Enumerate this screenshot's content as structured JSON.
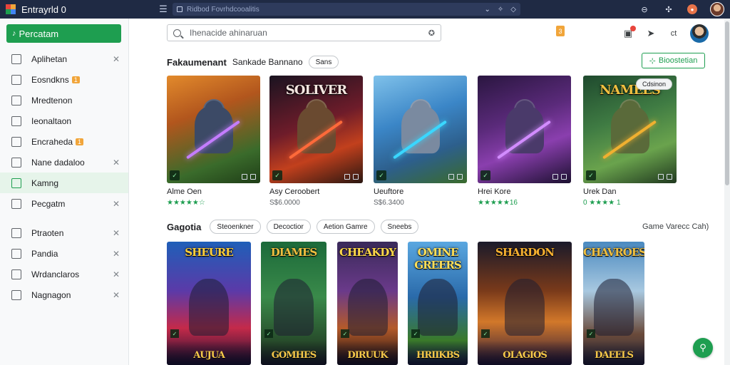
{
  "app": {
    "title": "Entrayrld 0"
  },
  "browser": {
    "address_placeholder": "Ridbod Fovrhdcooalitis"
  },
  "sidebar": {
    "primary_button": "Percatam",
    "items": [
      {
        "label": "Aplihetan",
        "closable": true
      },
      {
        "label": "Eosndkns",
        "badge": "1",
        "closable": false
      },
      {
        "label": "Mredtenon",
        "closable": false
      },
      {
        "label": "Ieonaltaon",
        "closable": false
      },
      {
        "label": "Encraheda",
        "badge": "1",
        "closable": false
      },
      {
        "label": "Nane dadaloo",
        "closable": true
      },
      {
        "label": "Kamng",
        "closable": false,
        "active": true
      },
      {
        "label": "Pecgatm",
        "closable": true
      },
      {
        "label": "Ptraoten",
        "closable": true
      },
      {
        "label": "Pandia",
        "closable": true
      },
      {
        "label": "Wrdanclaros",
        "closable": true
      },
      {
        "label": "Nagnagon",
        "closable": true
      }
    ]
  },
  "header": {
    "search_placeholder": "Ihenacide ahinaruan",
    "badge": "3",
    "action_label": "ct"
  },
  "featured": {
    "title": "Fakaumenant",
    "subtitle": "Sankade Bannano",
    "chip": "Sans",
    "button": "Bioostetian",
    "games": [
      {
        "title": "Alme Oen",
        "rating": "★★★★★☆",
        "thumb_title": ""
      },
      {
        "title": "Asy Ceroobert",
        "price": "S$6.0000",
        "thumb_title": "SOLIVER"
      },
      {
        "title": "Ueuftore",
        "price": "S$6.3400",
        "thumb_title": ""
      },
      {
        "title": "Hrei Kore",
        "rating": "★★★★★16",
        "thumb_title": ""
      },
      {
        "title": "Urek Dan",
        "rating": "0 ★★★★ 1",
        "thumb_title": "NAMEES",
        "edit_chip": "Cdsinon"
      }
    ]
  },
  "categories": {
    "title": "Gagotia",
    "chips": [
      "Steoenkner",
      "Decoctior",
      "Aetion Gamre",
      "Sneebs"
    ],
    "right_text": "Game Varecc Cah)",
    "posters": [
      {
        "title": "SHEURE",
        "foot": "AUJUA"
      },
      {
        "title": "DIAMES",
        "foot": "GOMHES"
      },
      {
        "title": "CHEAKDY",
        "foot": "DIRUUK"
      },
      {
        "title": "OMINE GREERS",
        "foot": "HRIIKBS"
      },
      {
        "title": "SHARDON",
        "foot": "OLAGIOS"
      },
      {
        "title": "CHAVROES",
        "foot": "DAEELS"
      }
    ]
  },
  "colors": {
    "accent": "#1e9e50",
    "topbar": "#1f2a44",
    "badge": "#f1a53a"
  }
}
